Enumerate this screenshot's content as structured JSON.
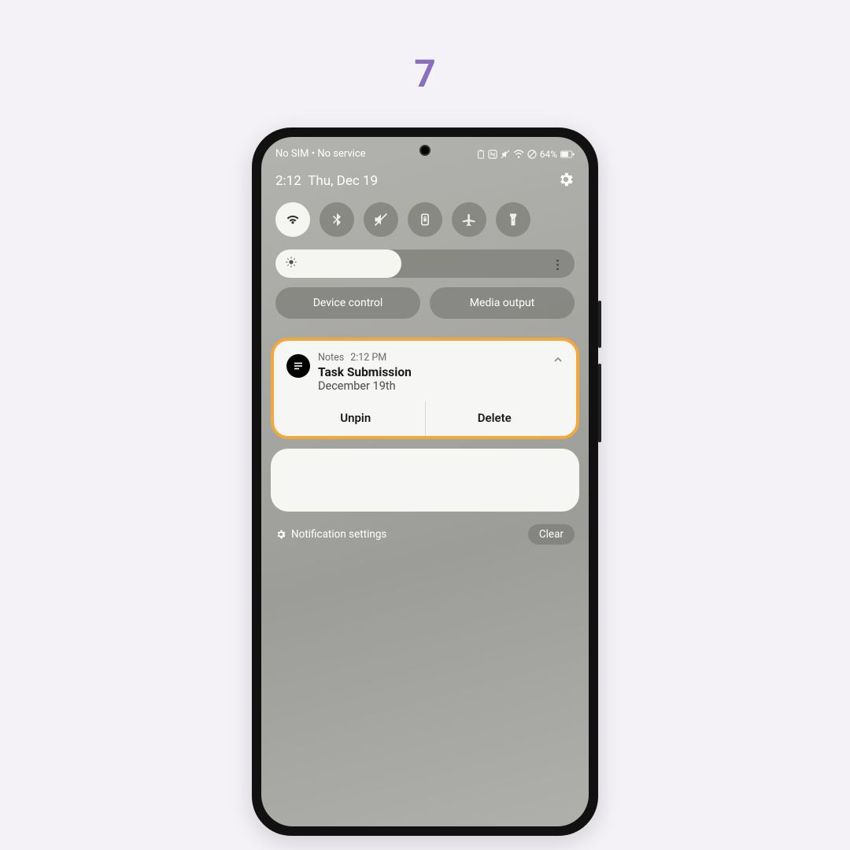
{
  "step_number": "7",
  "status": {
    "left": "No SIM • No service",
    "battery_pct": "64%"
  },
  "qs": {
    "time": "2:12",
    "date": "Thu, Dec 19",
    "tiles": [
      "wifi",
      "bluetooth",
      "mute",
      "rotation-lock",
      "airplane",
      "flashlight"
    ],
    "device_control": "Device control",
    "media_output": "Media output"
  },
  "notification": {
    "app": "Notes",
    "time": "2:12 PM",
    "title": "Task Submission",
    "body": "December 19th",
    "actions": {
      "unpin": "Unpin",
      "delete": "Delete"
    }
  },
  "footer": {
    "settings": "Notification settings",
    "clear": "Clear"
  }
}
